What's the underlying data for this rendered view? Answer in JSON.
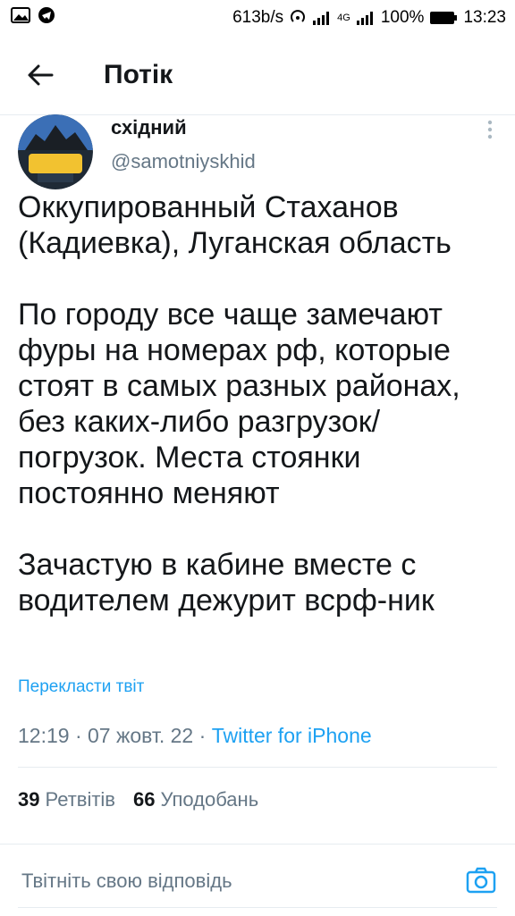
{
  "status_bar": {
    "speed": "613b/s",
    "network": "4G",
    "battery": "100%",
    "time": "13:23"
  },
  "header": {
    "title": "Потік"
  },
  "tweet": {
    "author_name": "східний",
    "author_handle": "@samotniyskhid",
    "paragraphs": [
      "Оккупированный Стаханов (Кадиевка), Луганская область",
      "По городу все чаще замечают фуры на номерах рф, которые стоят в самых разных районах, без каких-либо разгрузок/ погрузок. Места стоянки постоянно меняют",
      "Зачастую в кабине вместе с водителем дежурит всрф-ник"
    ],
    "translate_label": "Перекласти твіт",
    "time": "12:19",
    "date": "07 жовт. 22",
    "source": "Twitter for iPhone",
    "retweets_count": "39",
    "retweets_label": "Ретвітів",
    "likes_count": "66",
    "likes_label": "Уподобань"
  },
  "reply": {
    "placeholder": "Твітніть свою відповідь"
  },
  "colors": {
    "accent": "#1da1f2",
    "secondary_text": "#657786",
    "divider": "#e6ecf0"
  }
}
